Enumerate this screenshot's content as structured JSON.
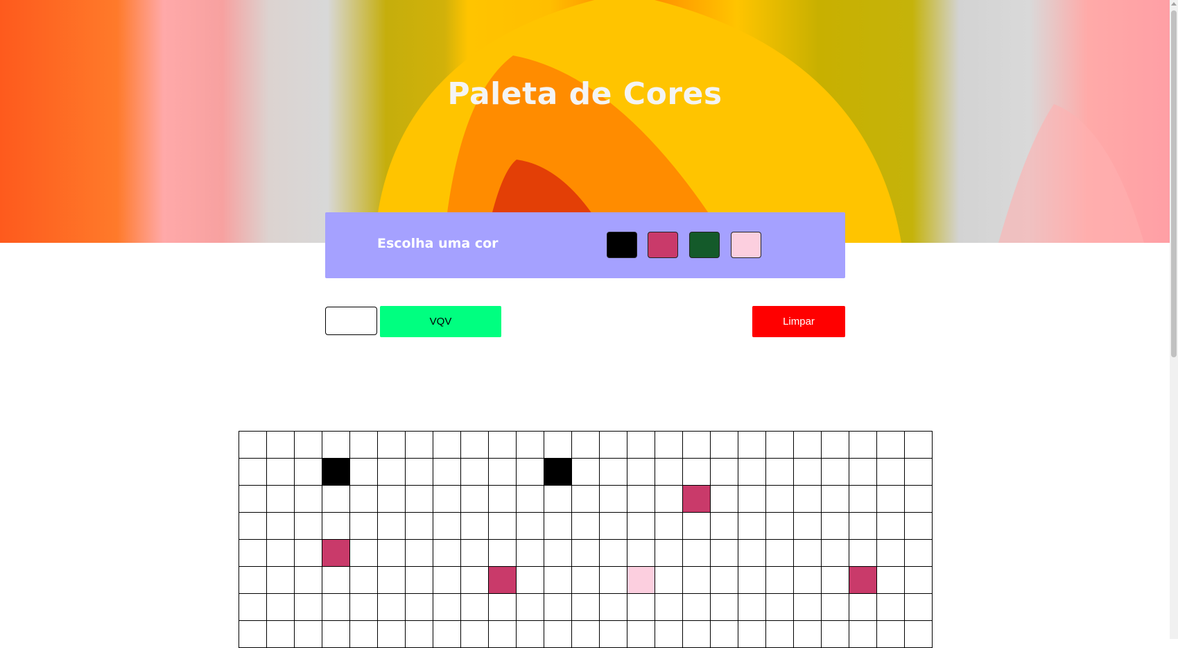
{
  "header": {
    "title": "Paleta de Cores"
  },
  "palette": {
    "label": "Escolha uma cor",
    "colors": [
      "#000000",
      "#c93a6a",
      "#145a2a",
      "#fccfdf"
    ]
  },
  "controls": {
    "board_size_value": "",
    "vqv_label": "VQV",
    "clear_label": "Limpar"
  },
  "board": {
    "columns": 25,
    "rows": 8,
    "colored": [
      {
        "row": 1,
        "col": 3,
        "color": "#000000"
      },
      {
        "row": 1,
        "col": 11,
        "color": "#000000"
      },
      {
        "row": 2,
        "col": 16,
        "color": "#c93a6a"
      },
      {
        "row": 4,
        "col": 3,
        "color": "#c93a6a"
      },
      {
        "row": 5,
        "col": 9,
        "color": "#c93a6a"
      },
      {
        "row": 5,
        "col": 14,
        "color": "#fccfdf"
      },
      {
        "row": 5,
        "col": 22,
        "color": "#c93a6a"
      }
    ]
  }
}
